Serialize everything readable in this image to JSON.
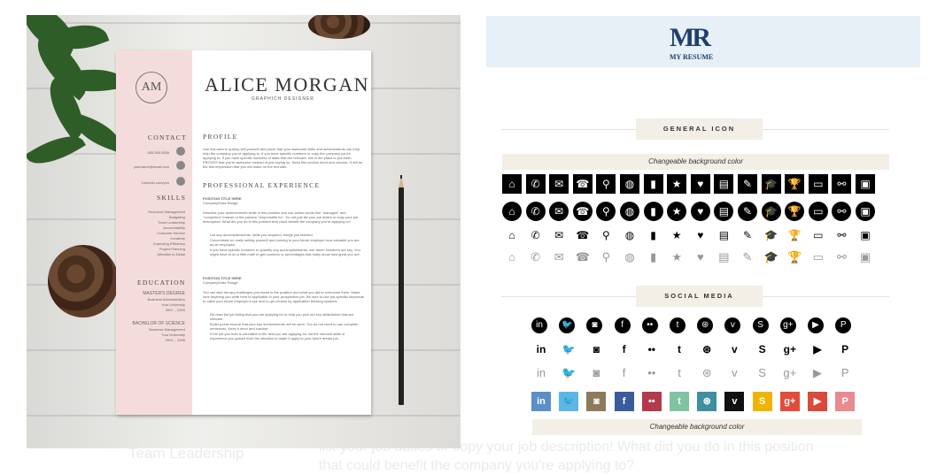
{
  "left_panel": {
    "monogram": "AM",
    "name": "ALICE MORGAN",
    "subtitle": "GRAPHICH DESIGNER",
    "sections": {
      "contact": "CONTACT",
      "skills": "SKILLS",
      "education": "EDUCATION",
      "profile": "PROFILE",
      "experience": "PROFESSIONAL EXPERIENCE"
    },
    "contact_items": [
      "555.555.5555",
      "yourname@email.com",
      "Linkedin.com/you"
    ],
    "skills": [
      "Resource Management",
      "Budgeting",
      "Team Leadership",
      "Accountability",
      "Customer Service",
      "Creativity",
      "Improving Efficiency",
      "Project Planning",
      "Attention to Detail"
    ],
    "education": [
      {
        "degree": "MASTER'S DEGREE",
        "lines": [
          "Business Administration",
          "Your University",
          "2007 – 2009"
        ]
      },
      {
        "degree": "BACHELOR OF SCIENCE",
        "lines": [
          "Business Management",
          "Your University",
          "2002 – 2006"
        ]
      }
    ],
    "profile_text": "Use this area to quickly sell yourself and prove that your awesome skills and achievements can truly help the company you're applying to. If you have specific numbers or copy the company you're applying to. If you have specific numbers or stats that are relevant, this is the place to put them. PROVES that you're awesome instead of just saying so. Keep this section short and concise. It will be the first impression that you will make on the recruiter.",
    "jobs": [
      {
        "title": "POSITION TITLE HERE",
        "company": "Company/Date Range",
        "desc": "Describe your achievements while in this position and use action words like \"managed\" and \"completed\" instead of the passive \"responsible for\". Do not just list your job duties or copy your job description! What did you do in this position that could benefit the company you're applying to?",
        "bullets": [
          "List any accomplishments, skills you acquired, things you learned.",
          "Concentrate on really selling yourself and proving to your future employer how valuable you are as an employee.",
          "If you have specific numbers to quantify any accomplishments, use them! Numbers are key. You might have to do a little math to get numbers or percentages that really show how great you are."
        ]
      },
      {
        "title": "POSITION TITLE HERE",
        "company": "Company/Date Range",
        "desc": "You can also list any challenges you faced in the position and what you did to overcome them. Make sure anything you write here is applicable to your prospective job. Be sure to use job-specific keywords to catch your future employer's eye and to get chosen by application tracking systems.",
        "bullets": [
          "Re-read the job listing that you are applying for to help you pick out key skills/duties that are relevant.",
          "Bullet points ensure that your key achievements will be seen. You do not need to use complete sentences. Keep it short and concise.",
          "If the job you hold is unrelated to the field you are applying for, list the relevant skills or experience you gained from the situation to make it apply to your future dream job."
        ]
      }
    ]
  },
  "right_panel": {
    "logo_text": "MR",
    "logo_subtitle": "MY RESUME",
    "general_icon_title": "GENERAL ICON",
    "social_media_title": "SOCIAL MEDIA",
    "caption": "Changeable background color",
    "general_icons": [
      "home-icon",
      "phone-icon",
      "mail-icon",
      "telephone-icon",
      "map-pin-icon",
      "globe-icon",
      "chart-icon",
      "star-icon",
      "heart-icon",
      "document-icon",
      "pen-icon",
      "graduation-cap-icon",
      "trophy-icon",
      "chat-icon",
      "paperclip-icon",
      "briefcase-icon"
    ],
    "general_glyphs": [
      "⌂",
      "✆",
      "✉",
      "☎",
      "⚲",
      "◍",
      "▮",
      "★",
      "♥",
      "▤",
      "✎",
      "🎓",
      "🏆",
      "▭",
      "⚯",
      "▣"
    ],
    "social_icons": [
      "linkedin-icon",
      "twitter-icon",
      "instagram-icon",
      "facebook-icon",
      "flickr-icon",
      "tumblr-icon",
      "dribbble-icon",
      "vimeo-icon",
      "skype-icon",
      "google-plus-icon",
      "youtube-icon",
      "pinterest-icon"
    ],
    "social_glyphs": [
      "in",
      "🐦",
      "◙",
      "f",
      "••",
      "t",
      "⊛",
      "v",
      "S",
      "g+",
      "▶",
      "P"
    ],
    "social_colors": [
      "#5b8fc7",
      "#5db6e8",
      "#8d7a5a",
      "#3b5c9c",
      "#b23a4a",
      "#7fc3a0",
      "#3e8fa0",
      "#111111",
      "#f0b400",
      "#e34c3a",
      "#d94a3a",
      "#e88a8e"
    ]
  },
  "background_text": {
    "line_a": "Team Leadership",
    "line_b": "list your job duties or copy your job description! What did you do in this position",
    "line_c": "that could benefit the company you're applying to?"
  }
}
